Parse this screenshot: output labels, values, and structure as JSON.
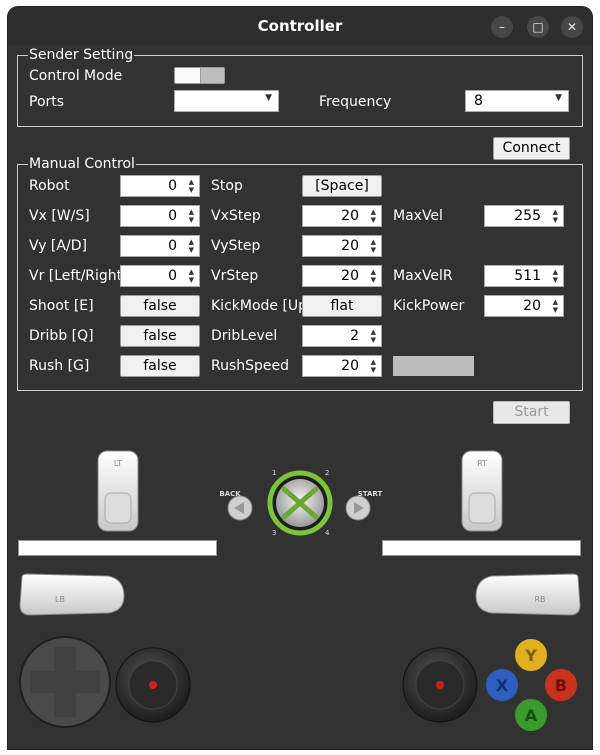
{
  "window": {
    "title": "Controller",
    "min_icon": "–",
    "max_icon": "□",
    "close_icon": "✕"
  },
  "sender": {
    "title": "Sender Setting",
    "control_mode_label": "Control Mode",
    "ports_label": "Ports",
    "ports_value": "",
    "frequency_label": "Frequency",
    "frequency_value": "8"
  },
  "connect_label": "Connect",
  "manual": {
    "title": "Manual Control",
    "robot_label": "Robot",
    "robot_value": "0",
    "stop_label": "Stop",
    "stop_button": "[Space]",
    "vx_label": "Vx [W/S]",
    "vx_value": "0",
    "vxstep_label": "VxStep",
    "vxstep_value": "20",
    "maxvel_label": "MaxVel",
    "maxvel_value": "255",
    "vy_label": "Vy [A/D]",
    "vy_value": "0",
    "vystep_label": "VyStep",
    "vystep_value": "20",
    "vr_label": "Vr [Left/Right]",
    "vr_value": "0",
    "vrstep_label": "VrStep",
    "vrstep_value": "20",
    "maxvelr_label": "MaxVelR",
    "maxvelr_value": "511",
    "shoot_label": "Shoot [E]",
    "shoot_value": "false",
    "kickmode_label": "KickMode [Up/Down]",
    "kickmode_value": "flat",
    "kickpower_label": "KickPower",
    "kickpower_value": "20",
    "dribb_label": "Dribb [Q]",
    "dribb_value": "false",
    "driblevel_label": "DribLevel",
    "driblevel_value": "2",
    "rush_label": "Rush [G]",
    "rush_value": "false",
    "rushspeed_label": "RushSpeed",
    "rushspeed_value": "20"
  },
  "start_label": "Start",
  "gamepad": {
    "lt": "LT",
    "rt": "RT",
    "lb": "LB",
    "rb": "RB",
    "back": "BACK",
    "start": "START",
    "y": "Y",
    "x": "X",
    "b": "B",
    "a": "A",
    "q1": "1",
    "q2": "2",
    "q3": "3",
    "q4": "4"
  },
  "colors": {
    "window_bg": "#323232",
    "y": "#e0b020",
    "x": "#2c5fbf",
    "b": "#c8321e",
    "a": "#3a9a2c",
    "guide": "#7dc43a"
  }
}
